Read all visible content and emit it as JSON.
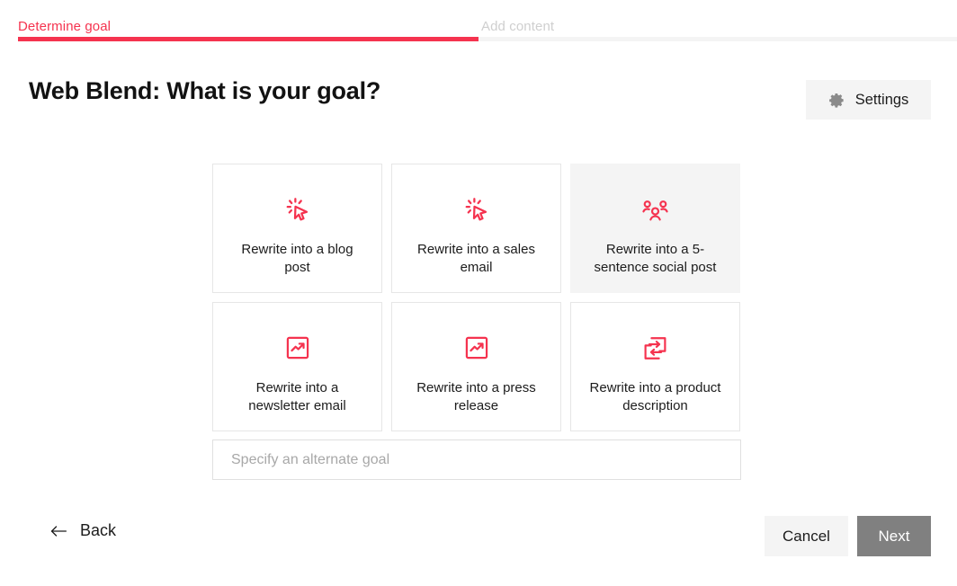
{
  "stepper": {
    "steps": [
      {
        "label": "Determine goal",
        "state": "active"
      },
      {
        "label": "Add content",
        "state": "inactive"
      }
    ],
    "progress_percent": 49,
    "active_color": "#f5334f",
    "track_color": "#f4f4f4",
    "inactive_label_color": "#cfcfcf"
  },
  "header": {
    "title": "Web Blend: What is your goal?",
    "settings_label": "Settings",
    "settings_icon": "gear-icon"
  },
  "goals": {
    "cards": [
      {
        "label": "Rewrite into a blog\npost",
        "icon": "cursor-click-icon",
        "selected": false
      },
      {
        "label": "Rewrite into a sales\nemail",
        "icon": "cursor-click-icon",
        "selected": false
      },
      {
        "label": "Rewrite into a 5-\nsentence social post",
        "icon": "users-group-icon",
        "selected": true
      },
      {
        "label": "Rewrite into a\nnewsletter email",
        "icon": "trending-up-boxed-icon",
        "selected": false
      },
      {
        "label": "Rewrite into a press\nrelease",
        "icon": "trending-up-boxed-icon",
        "selected": false
      },
      {
        "label": "Rewrite into a product\ndescription",
        "icon": "transfer-exchange-icon",
        "selected": false
      }
    ],
    "icon_color": "#f5334f",
    "selected_background": "#f4f4f4"
  },
  "alternate_goal": {
    "placeholder": "Specify an alternate goal",
    "value": ""
  },
  "footer": {
    "back_label": "Back",
    "back_icon": "arrow-left-icon",
    "cancel_label": "Cancel",
    "next_label": "Next",
    "next_disabled": true,
    "next_background": "#808080",
    "cancel_background": "#f4f4f4"
  }
}
